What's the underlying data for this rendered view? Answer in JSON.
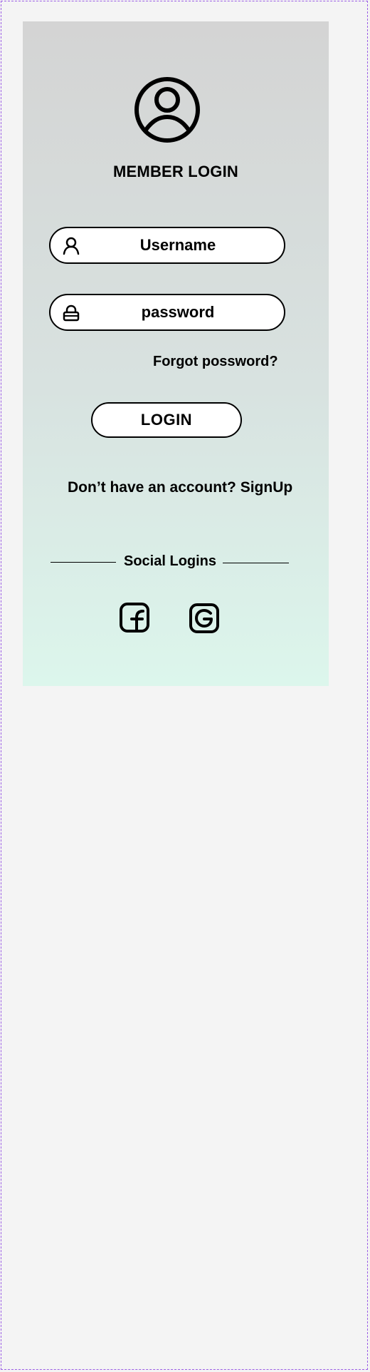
{
  "login_card": {
    "title": "MEMBER LOGIN",
    "username_placeholder": "Username",
    "password_placeholder": "password",
    "forgot_password_label": "Forgot possword?",
    "login_button_label": "LOGIN",
    "signup_prompt": "Don’t have an account? ",
    "signup_link_label": "SignUp",
    "social_title": "Social Logins"
  },
  "icons": {
    "avatar": "user-circle-icon",
    "username": "user-icon",
    "password": "lock-icon",
    "facebook": "facebook-icon",
    "google": "google-icon"
  },
  "colors": {
    "page_background": "#f4f4f4",
    "card_gradient_top": "#d4d4d4",
    "card_gradient_bottom": "#dcf6ec",
    "frame_border": "#9b5de5"
  }
}
